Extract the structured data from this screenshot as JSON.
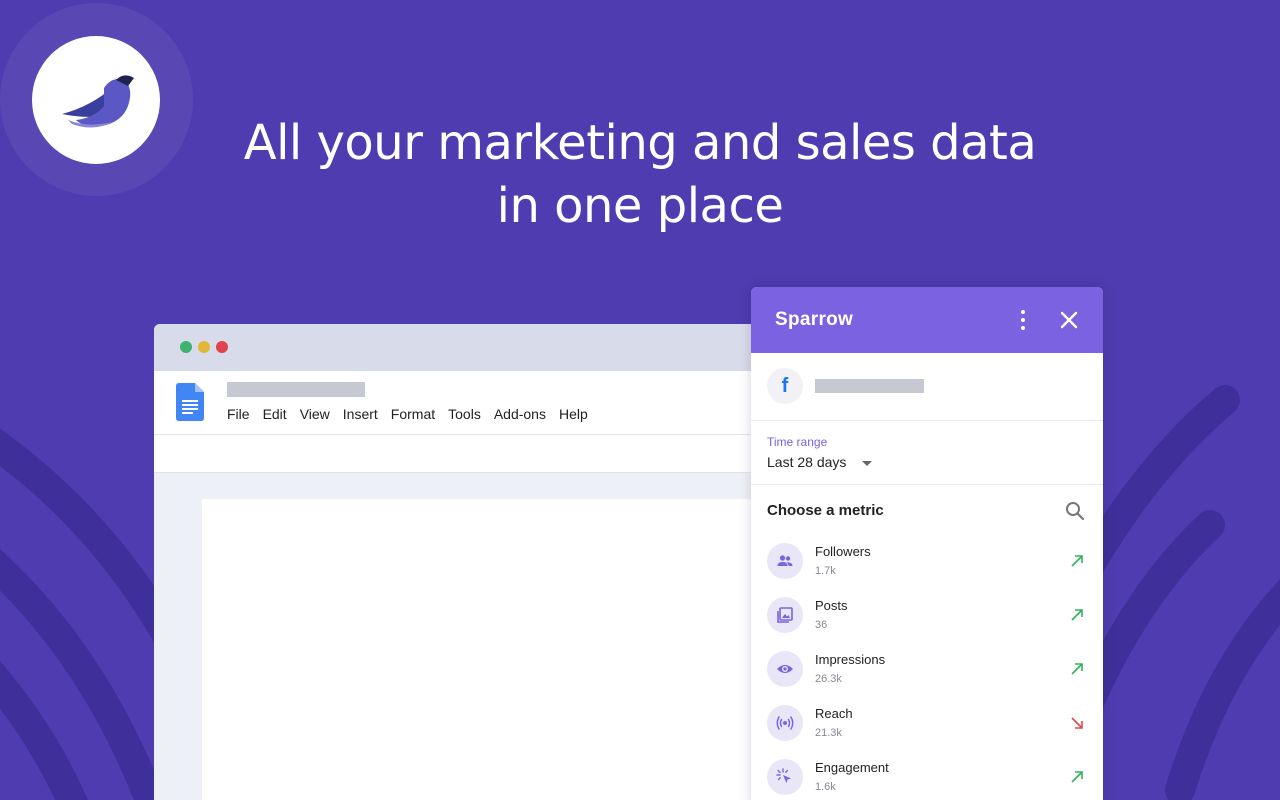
{
  "headline": {
    "line1": "All your marketing and sales data",
    "line2": "in one place"
  },
  "colors": {
    "background": "#4f3cb0",
    "panel_header": "#7a62e0",
    "trend_up": "#2fb45a",
    "trend_down": "#e04848"
  },
  "docs_window": {
    "menu": [
      "File",
      "Edit",
      "View",
      "Insert",
      "Format",
      "Tools",
      "Add-ons",
      "Help"
    ]
  },
  "panel": {
    "title": "Sparrow",
    "account_icon": "facebook-icon",
    "time_range": {
      "label": "Time range",
      "value": "Last 28 days"
    },
    "metrics_heading": "Choose a metric",
    "metrics": [
      {
        "name": "Followers",
        "value": "1.7k",
        "icon": "people-icon",
        "trend": "up"
      },
      {
        "name": "Posts",
        "value": "36",
        "icon": "image-icon",
        "trend": "up"
      },
      {
        "name": "Impressions",
        "value": "26.3k",
        "icon": "eye-icon",
        "trend": "up"
      },
      {
        "name": "Reach",
        "value": "21.3k",
        "icon": "broadcast-icon",
        "trend": "down"
      },
      {
        "name": "Engagement",
        "value": "1.6k",
        "icon": "click-icon",
        "trend": "up"
      }
    ]
  }
}
